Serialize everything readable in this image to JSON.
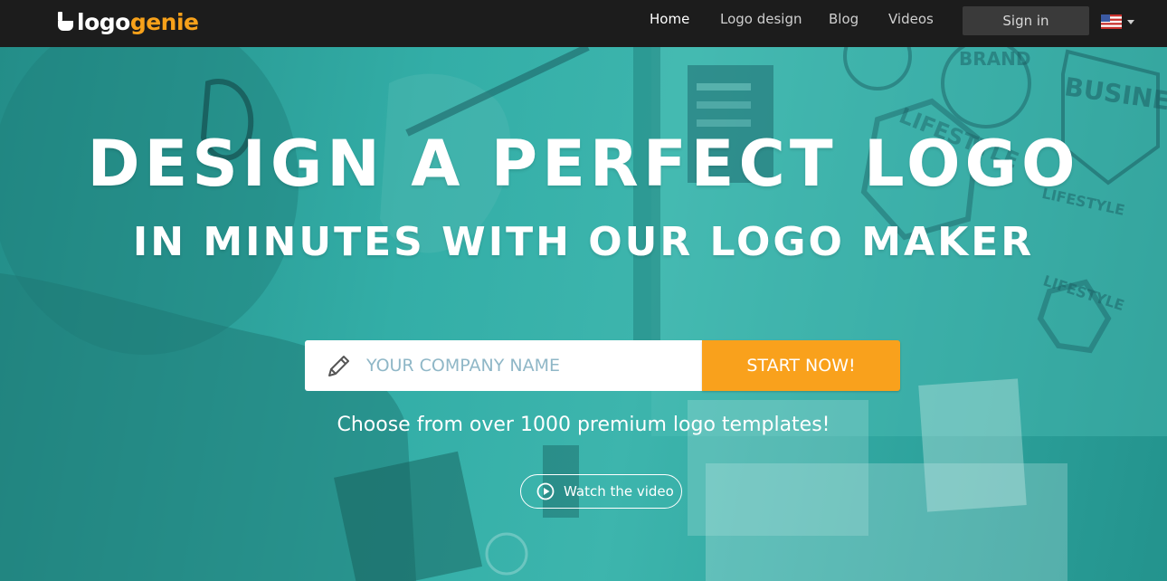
{
  "brand": {
    "name_part1": "logo",
    "name_part2": "genie",
    "accent_color": "#f7a11a"
  },
  "nav": {
    "items": [
      {
        "label": "Home",
        "active": true
      },
      {
        "label": "Logo design",
        "active": false
      },
      {
        "label": "Blog",
        "active": false
      },
      {
        "label": "Videos",
        "active": false
      }
    ],
    "signin_label": "Sign in",
    "language_icon": "us-flag-icon"
  },
  "hero": {
    "headline_line1": "DESIGN A PERFECT LOGO",
    "headline_line2": "IN MINUTES WITH OUR LOGO MAKER",
    "overlay_color": "#2fa9a3",
    "search": {
      "placeholder": "YOUR COMPANY NAME",
      "value": "",
      "icon": "pencil-icon"
    },
    "cta_label": "START NOW!",
    "cta_color": "#f9a11c",
    "tagline": "Choose from over 1000 premium logo templates!",
    "video_label": "Watch the video",
    "video_icon": "play-circle-icon",
    "background_art": {
      "badge_text_1": "BUSINESS",
      "badge_text_2": "LIFESTYLE",
      "badge_text_3": "LIFESTYLE",
      "badge_text_4": "LIFESTYLE",
      "badge_text_5": "BRAND"
    }
  }
}
